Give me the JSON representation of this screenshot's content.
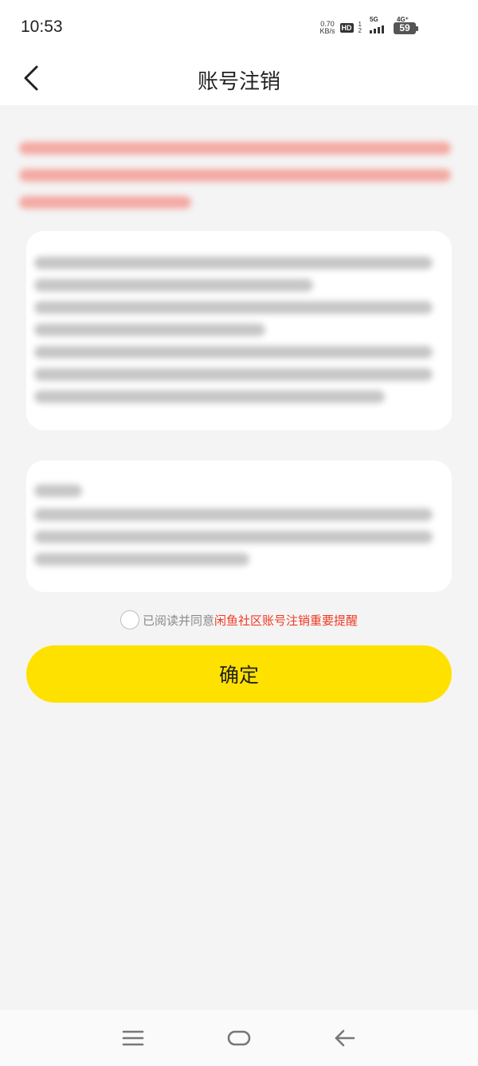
{
  "status_bar": {
    "time": "10:53",
    "net_speed_value": "0.70",
    "net_speed_unit": "KB/s",
    "hd_label": "HD",
    "sim1_label": "1",
    "sim2_label": "2",
    "signal1_label": "5G",
    "signal2_label": "4G⁺",
    "battery_level": "59"
  },
  "header": {
    "title": "账号注销"
  },
  "agreement": {
    "prefix": "已阅读并同意",
    "link_text": "闲鱼社区账号注销重要提醒"
  },
  "confirm_button": {
    "label": "确定"
  },
  "colors": {
    "accent_yellow": "#ffe100",
    "link_red": "#f03a24",
    "background": "#f4f4f4"
  },
  "icons": {
    "back": "chevron-left-icon",
    "menu": "menu-icon",
    "home": "home-icon",
    "nav_back": "arrow-left-icon"
  }
}
